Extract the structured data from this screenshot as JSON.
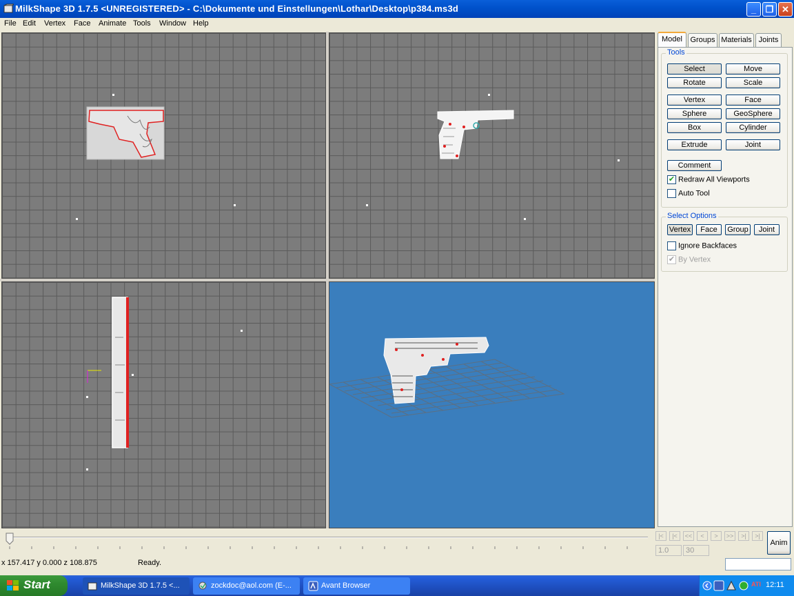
{
  "window": {
    "title": "MilkShape 3D 1.7.5 <UNREGISTERED> - C:\\Dokumente und Einstellungen\\Lothar\\Desktop\\p384.ms3d",
    "minimize": "_",
    "maximize": "❐",
    "close": "✕"
  },
  "menu": [
    "File",
    "Edit",
    "Vertex",
    "Face",
    "Animate",
    "Tools",
    "Window",
    "Help"
  ],
  "tabs": [
    "Model",
    "Groups",
    "Materials",
    "Joints"
  ],
  "tools": {
    "label": "Tools",
    "buttons": [
      "Select",
      "Move",
      "Rotate",
      "Scale",
      "Vertex",
      "Face",
      "Sphere",
      "GeoSphere",
      "Box",
      "Cylinder",
      "Extrude",
      "Joint",
      "Comment"
    ],
    "redraw_all": "Redraw All Viewports",
    "auto_tool": "Auto Tool"
  },
  "select_options": {
    "label": "Select Options",
    "buttons": [
      "Vertex",
      "Face",
      "Group",
      "Joint"
    ],
    "ignore_backfaces": "Ignore Backfaces",
    "by_vertex": "By Vertex"
  },
  "timeline": {
    "frame": "1.0",
    "total": "30",
    "anim": "Anim",
    "nav": [
      "|<",
      "|<",
      "<<",
      "<",
      ">",
      ">>",
      ">|",
      ">|"
    ]
  },
  "status": {
    "coords": "x 157.417 y 0.000 z 108.875",
    "message": "Ready."
  },
  "taskbar": {
    "start": "Start",
    "tasks": [
      "MilkShape 3D 1.7.5 <...",
      "zockdoc@aol.com (E-...",
      "Avant Browser"
    ],
    "clock": "12:11",
    "ati": "ATI"
  },
  "colors": {
    "viewport_bg": "#7c7c7c",
    "viewport_3d_bg": "#3a7ebd",
    "selection_red": "#e02020",
    "title_blue": "#0052cc"
  }
}
